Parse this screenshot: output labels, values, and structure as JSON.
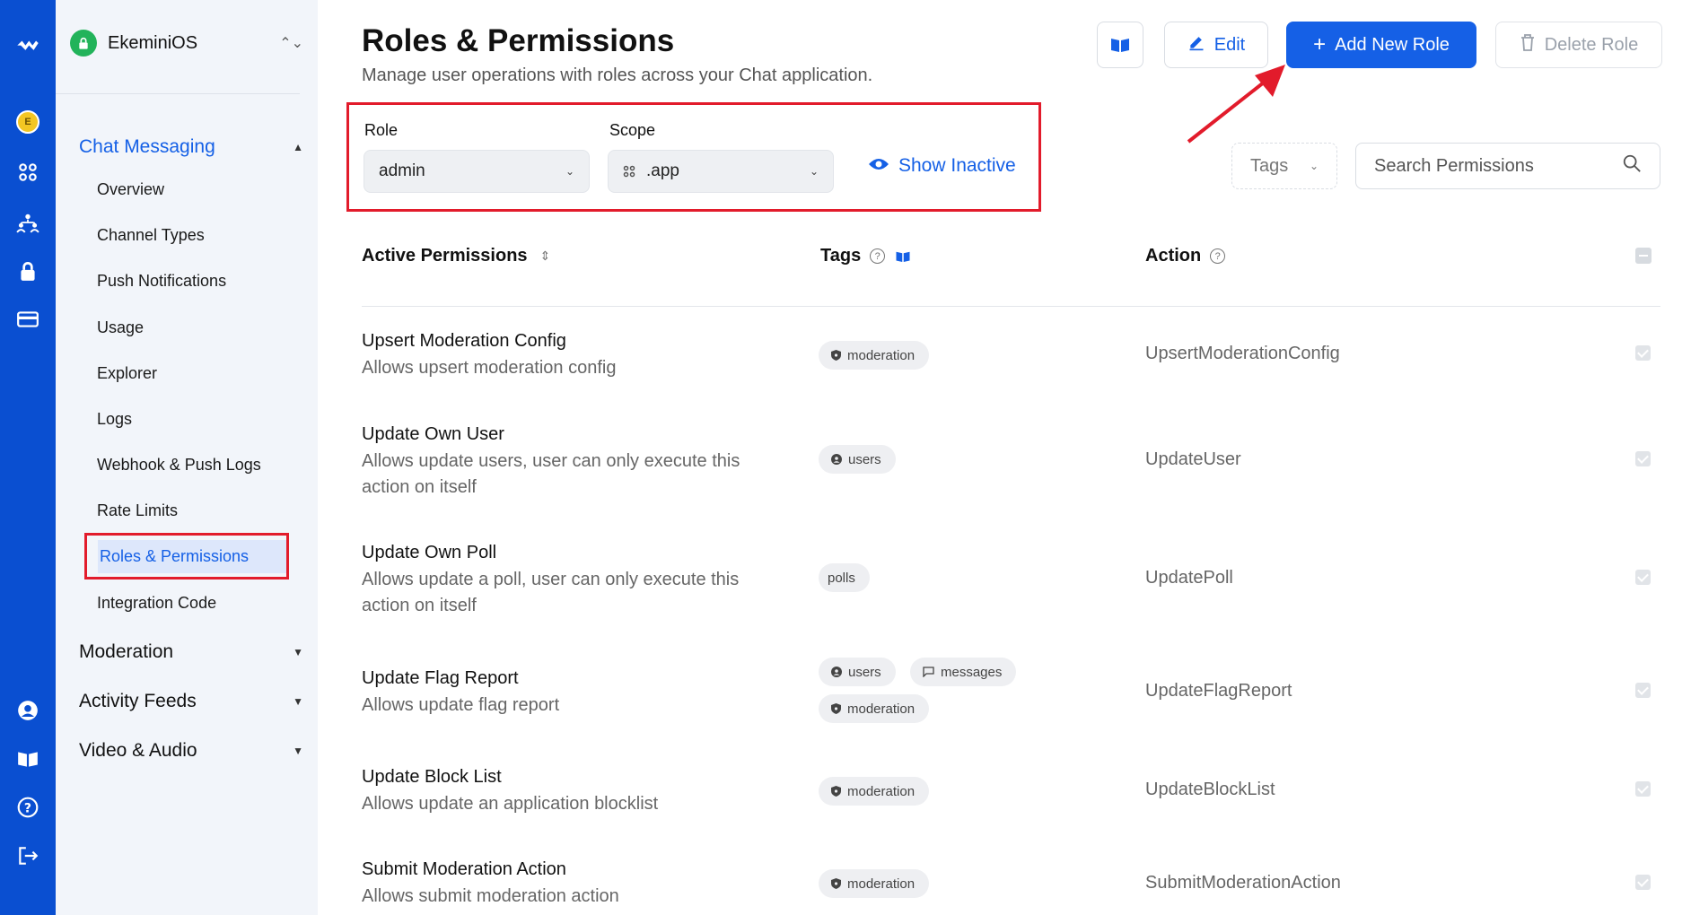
{
  "org": {
    "name": "EkeminiOS"
  },
  "rail": {
    "avatar_letter": "E"
  },
  "sidebar": {
    "sections": [
      {
        "label": "Chat Messaging",
        "expanded": true
      },
      {
        "label": "Moderation"
      },
      {
        "label": "Activity Feeds"
      },
      {
        "label": "Video & Audio"
      }
    ],
    "items": [
      {
        "label": "Overview"
      },
      {
        "label": "Channel Types"
      },
      {
        "label": "Push Notifications"
      },
      {
        "label": "Usage"
      },
      {
        "label": "Explorer"
      },
      {
        "label": "Logs"
      },
      {
        "label": "Webhook & Push Logs"
      },
      {
        "label": "Rate Limits"
      },
      {
        "label": "Roles & Permissions",
        "selected": true
      },
      {
        "label": "Integration Code"
      }
    ]
  },
  "header": {
    "title": "Roles & Permissions",
    "subtitle": "Manage user operations with roles across your Chat application.",
    "edit_label": "Edit",
    "add_role_label": "Add New Role",
    "delete_role_label": "Delete Role"
  },
  "filters": {
    "role_label": "Role",
    "role_value": "admin",
    "scope_label": "Scope",
    "scope_value": ".app",
    "show_inactive_label": "Show Inactive",
    "tags_label": "Tags",
    "search_placeholder": "Search Permissions"
  },
  "table": {
    "headers": {
      "permissions": "Active Permissions",
      "tags": "Tags",
      "action": "Action"
    },
    "rows": [
      {
        "name": "Upsert Moderation Config",
        "desc": "Allows upsert moderation config",
        "tags": [
          "moderation"
        ],
        "action": "UpsertModerationConfig"
      },
      {
        "name": "Update Own User",
        "desc": "Allows update users, user can only execute this action on itself",
        "tags": [
          "users"
        ],
        "action": "UpdateUser"
      },
      {
        "name": "Update Own Poll",
        "desc": "Allows update a poll, user can only execute this action on itself",
        "tags": [
          "polls"
        ],
        "action": "UpdatePoll"
      },
      {
        "name": "Update Flag Report",
        "desc": "Allows update flag report",
        "tags": [
          "users",
          "messages",
          "moderation"
        ],
        "action": "UpdateFlagReport"
      },
      {
        "name": "Update Block List",
        "desc": "Allows update an application blocklist",
        "tags": [
          "moderation"
        ],
        "action": "UpdateBlockList"
      },
      {
        "name": "Submit Moderation Action",
        "desc": "Allows submit moderation action",
        "tags": [
          "moderation"
        ],
        "action": "SubmitModerationAction"
      }
    ]
  },
  "colors": {
    "brand": "#1560e6",
    "rail": "#0a4fd1",
    "highlight": "#e21b2b"
  }
}
